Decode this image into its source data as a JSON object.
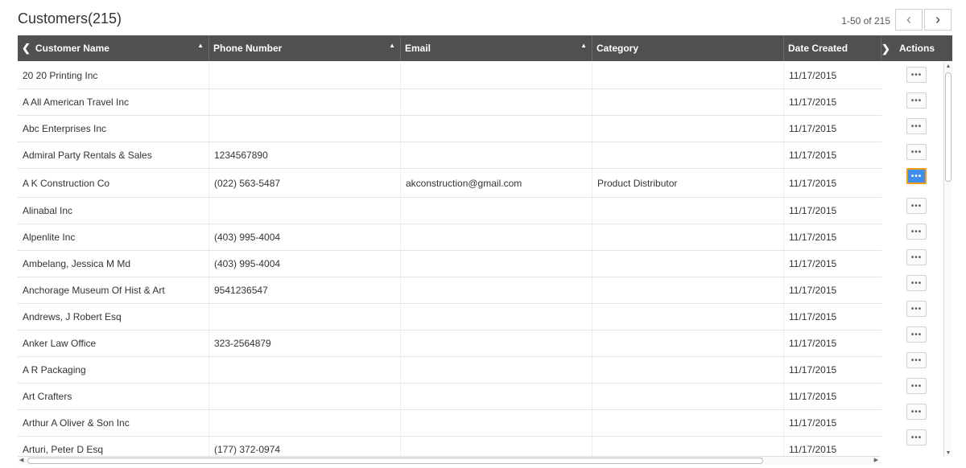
{
  "page": {
    "title": "Customers(215)"
  },
  "pagination": {
    "range_text": "1-50 of 215",
    "prev_icon": "‹",
    "next_icon": "›"
  },
  "columns": {
    "name": "Customer Name",
    "phone": "Phone Number",
    "email": "Email",
    "category": "Category",
    "date": "Date Created",
    "actions": "Actions"
  },
  "action_label": "•••",
  "rows": [
    {
      "name": "20 20 Printing Inc",
      "phone": "",
      "email": "",
      "category": "",
      "date": "11/17/2015"
    },
    {
      "name": "A All American Travel Inc",
      "phone": "",
      "email": "",
      "category": "",
      "date": "11/17/2015"
    },
    {
      "name": "Abc Enterprises Inc",
      "phone": "",
      "email": "",
      "category": "",
      "date": "11/17/2015"
    },
    {
      "name": "Admiral Party Rentals & Sales",
      "phone": "1234567890",
      "email": "",
      "category": "",
      "date": "11/17/2015"
    },
    {
      "name": "A K Construction Co",
      "phone": "(022) 563-5487",
      "email": "akconstruction@gmail.com",
      "category": "Product Distributor",
      "date": "11/17/2015",
      "selected": true
    },
    {
      "name": "Alinabal Inc",
      "phone": "",
      "email": "",
      "category": "",
      "date": "11/17/2015"
    },
    {
      "name": "Alpenlite Inc",
      "phone": "(403) 995-4004",
      "email": "",
      "category": "",
      "date": "11/17/2015"
    },
    {
      "name": "Ambelang, Jessica M Md",
      "phone": "(403) 995-4004",
      "email": "",
      "category": "",
      "date": "11/17/2015"
    },
    {
      "name": "Anchorage Museum Of Hist & Art",
      "phone": "9541236547",
      "email": "",
      "category": "",
      "date": "11/17/2015"
    },
    {
      "name": "Andrews, J Robert Esq",
      "phone": "",
      "email": "",
      "category": "",
      "date": "11/17/2015"
    },
    {
      "name": "Anker Law Office",
      "phone": "323-2564879",
      "email": "",
      "category": "",
      "date": "11/17/2015"
    },
    {
      "name": "A R Packaging",
      "phone": "",
      "email": "",
      "category": "",
      "date": "11/17/2015"
    },
    {
      "name": "Art Crafters",
      "phone": "",
      "email": "",
      "category": "",
      "date": "11/17/2015"
    },
    {
      "name": "Arthur A Oliver & Son Inc",
      "phone": "",
      "email": "",
      "category": "",
      "date": "11/17/2015"
    },
    {
      "name": "Arturi, Peter D Esq",
      "phone": "(177) 372-0974",
      "email": "",
      "category": "",
      "date": "11/17/2015"
    }
  ],
  "colors": {
    "header_bg": "#505050",
    "selected_action": "#3d8ef0",
    "focus_border": "#f39c12"
  }
}
